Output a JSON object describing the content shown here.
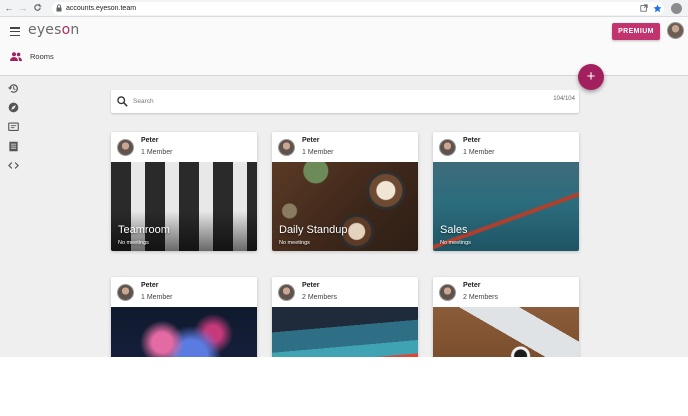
{
  "browser": {
    "url": "accounts.eyeson.team",
    "back_glyph": "←",
    "forward_glyph": "→",
    "reload_glyph": "C"
  },
  "app": {
    "logo_prefix": "eyes",
    "logo_accent": "o",
    "logo_suffix": "n",
    "premium_label": "PREMIUM",
    "nav_label": "Rooms",
    "fab_glyph": "+",
    "brand_color": "#a3205e"
  },
  "search": {
    "placeholder": "Search",
    "value": "",
    "count": "104/104"
  },
  "rail": [
    "history-icon",
    "explore-icon",
    "chat-icon",
    "list-icon",
    "code-icon"
  ],
  "rooms": [
    {
      "owner": "Peter",
      "members": "1 Member",
      "title": "Teamroom",
      "status": "No meetings"
    },
    {
      "owner": "Peter",
      "members": "1 Member",
      "title": "Daily Standup",
      "status": "No meetings"
    },
    {
      "owner": "Peter",
      "members": "1 Member",
      "title": "Sales",
      "status": "No meetings"
    },
    {
      "owner": "Peter",
      "members": "1 Member",
      "title": "",
      "status": ""
    },
    {
      "owner": "Peter",
      "members": "2 Members",
      "title": "",
      "status": ""
    },
    {
      "owner": "Peter",
      "members": "2 Members",
      "title": "",
      "status": ""
    }
  ]
}
